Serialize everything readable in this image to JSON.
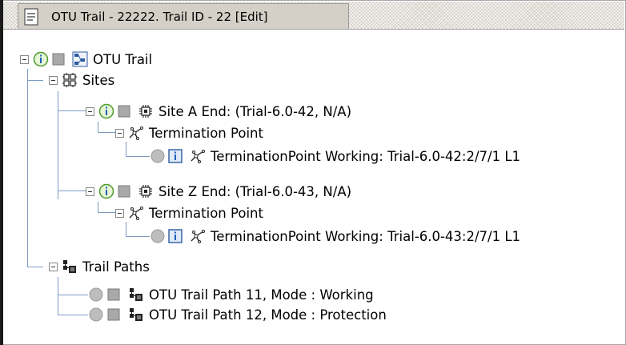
{
  "window": {
    "tab_title": "OTU Trail - 22222. Trail ID - 22 [Edit]"
  },
  "tree": {
    "root": {
      "label": "OTU Trail"
    },
    "sites": {
      "label": "Sites",
      "site_a": {
        "label": "Site A End: (Trial-6.0-42, N/A)",
        "tp_group": "Termination Point",
        "tp": "TerminationPoint Working: Trial-6.0-42:2/7/1 L1"
      },
      "site_z": {
        "label": "Site Z End: (Trial-6.0-43, N/A)",
        "tp_group": "Termination Point",
        "tp": "TerminationPoint Working: Trial-6.0-43:2/7/1 L1"
      }
    },
    "trail_paths": {
      "label": "Trail Paths",
      "items": [
        "OTU Trail Path 11, Mode : Working",
        "OTU Trail Path 12, Mode : Protection"
      ]
    }
  },
  "icons": {
    "info": "info-circle-icon",
    "status": "status-square-icon",
    "trail": "trail-icon",
    "sites": "sites-grid-icon",
    "site": "site-chip-icon",
    "termination": "termination-point-icon",
    "path": "trail-path-icon",
    "document": "document-icon"
  }
}
